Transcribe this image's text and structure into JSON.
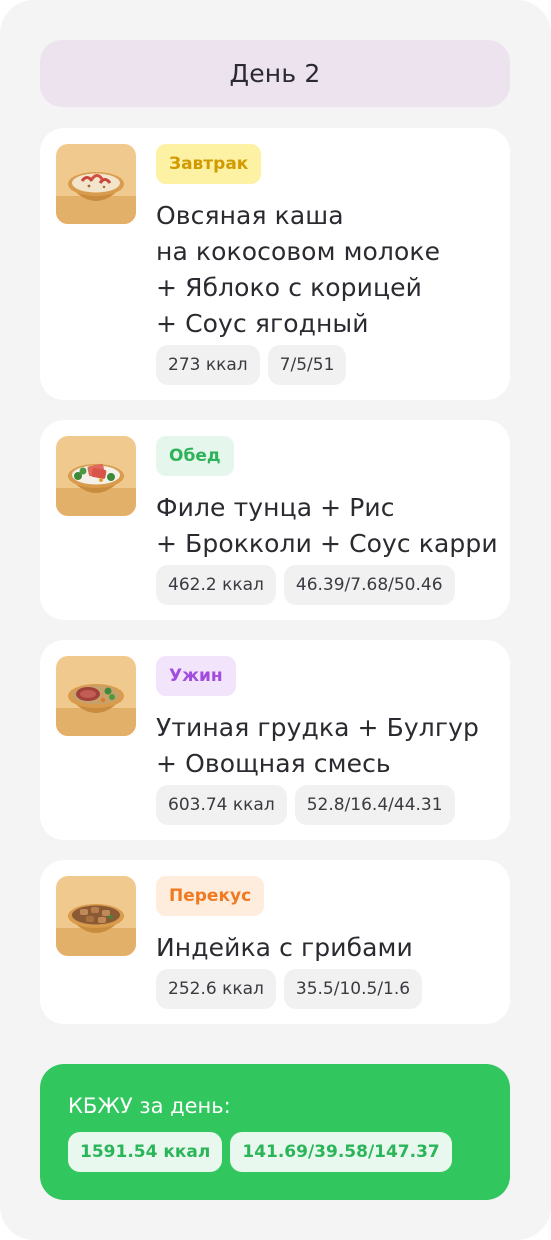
{
  "header": {
    "title": "День 2"
  },
  "meals": [
    {
      "tag": "Завтрак",
      "tag_color": "#d39a00",
      "tag_bg": "#fdf1a4",
      "title": "Овсяная каша\nна кокосовом молоке\n+ Яблоко с корицей\n+ Соус ягодный",
      "kcal": "273 ккал",
      "macros": "7/5/51",
      "image_icon": "oatmeal-bowl-photo"
    },
    {
      "tag": "Обед",
      "tag_color": "#2eb35a",
      "tag_bg": "#e5f7ec",
      "title": "Филе тунца + Рис\n+ Брокколи + Соус карри",
      "kcal": "462.2 ккал",
      "macros": "46.39/7.68/50.46",
      "image_icon": "tuna-rice-bowl-photo"
    },
    {
      "tag": "Ужин",
      "tag_color": "#a04de0",
      "tag_bg": "#f2e4fb",
      "title": "Утиная грудка + Булгур\n+ Овощная смесь",
      "kcal": "603.74 ккал",
      "macros": "52.8/16.4/44.31",
      "image_icon": "duck-bulgur-bowl-photo"
    },
    {
      "tag": "Перекус",
      "tag_color": "#f07a22",
      "tag_bg": "#feecdc",
      "title": "Индейка с грибами",
      "kcal": "252.6 ккал",
      "macros": "35.5/10.5/1.6",
      "image_icon": "turkey-mushroom-bowl-photo"
    }
  ],
  "summary": {
    "title": "КБЖУ за день:",
    "kcal": "1591.54 ккал",
    "macros": "141.69/39.58/147.37",
    "bg_color": "#31c75e"
  }
}
